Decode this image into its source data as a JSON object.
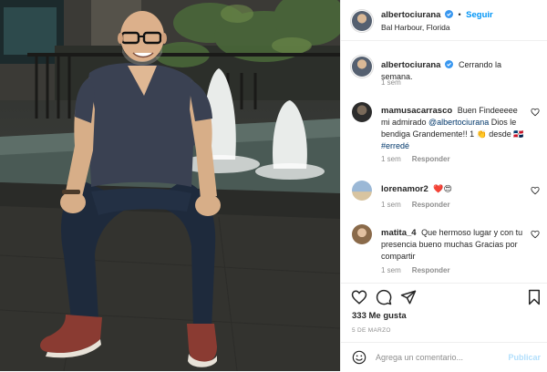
{
  "header": {
    "username": "albertociurana",
    "separator": "•",
    "follow_label": "Seguir",
    "location": "Bal Harbour, Florida"
  },
  "caption": {
    "username": "albertociurana",
    "text": "Cerrando la semana.",
    "time": "1 sem"
  },
  "comments": [
    {
      "username": "mamusacarrasco",
      "text_before": "Buen Findeeeee mi admirado ",
      "mention": "@albertociurana",
      "text_after": " Dios le bendiga Grandemente!! 1 👏 desde 🇩🇴",
      "hashtag": "#erredé",
      "time": "1 sem",
      "reply_label": "Responder"
    },
    {
      "username": "lorenamor2",
      "text": "❤️😍",
      "time": "1 sem",
      "reply_label": "Responder"
    },
    {
      "username": "matita_4",
      "text": "Que hermoso lugar y con tu presencia bueno muchas Gracias por compartir",
      "time": "1 sem",
      "reply_label": "Responder"
    }
  ],
  "footer": {
    "likes": "333 Me gusta",
    "date": "5 DE MARZO",
    "comment_placeholder": "Agrega un comentario...",
    "publish_label": "Publicar"
  },
  "colors": {
    "accent": "#0095f6",
    "publish_disabled": "#b2dffc",
    "muted": "#8e8e8e",
    "link": "#00376b"
  },
  "icons": [
    "verified-badge-icon",
    "like-heart-icon",
    "comment-icon",
    "share-icon",
    "save-bookmark-icon",
    "emoji-icon"
  ]
}
